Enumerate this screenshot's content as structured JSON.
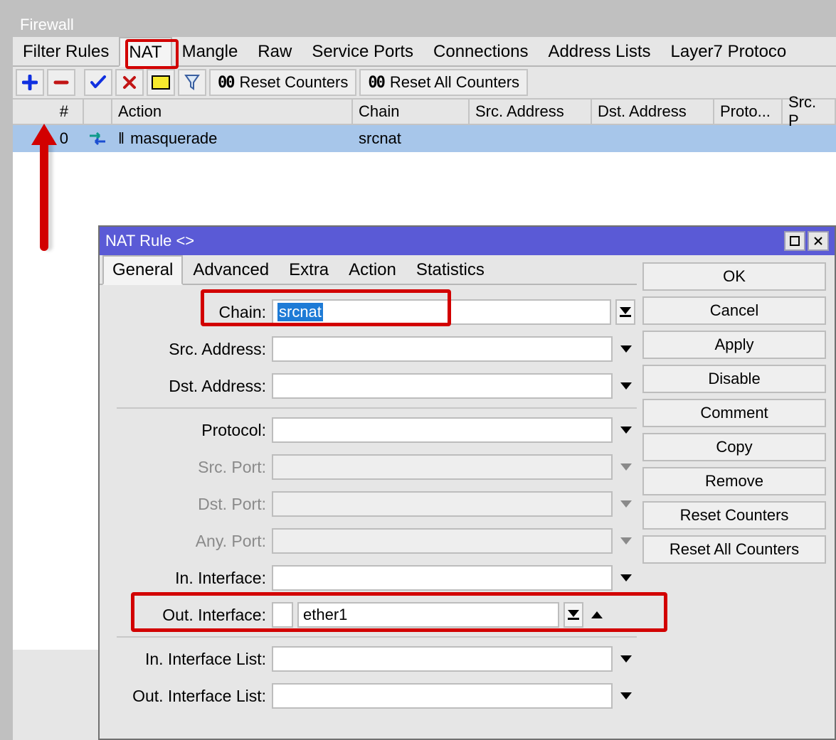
{
  "fw": {
    "title": "Firewall",
    "tabs": [
      "Filter Rules",
      "NAT",
      "Mangle",
      "Raw",
      "Service Ports",
      "Connections",
      "Address Lists",
      "Layer7 Protoco"
    ],
    "active_tab_index": 1,
    "toolbar": {
      "reset": "Reset Counters",
      "reset_all": "Reset All Counters"
    },
    "columns": {
      "idx": "#",
      "action": "Action",
      "chain": "Chain",
      "src": "Src. Address",
      "dst": "Dst. Address",
      "proto": "Proto...",
      "srcp": "Src. P"
    },
    "rows": [
      {
        "index": "0",
        "action": "masquerade",
        "chain": "srcnat",
        "src": "",
        "dst": "",
        "proto": "",
        "srcp": ""
      }
    ]
  },
  "dlg": {
    "title": "NAT Rule <>",
    "tabs": [
      "General",
      "Advanced",
      "Extra",
      "Action",
      "Statistics"
    ],
    "active_tab_index": 0,
    "fields": {
      "chain": {
        "label": "Chain:",
        "value": "srcnat"
      },
      "srcaddr": {
        "label": "Src. Address:",
        "value": ""
      },
      "dstaddr": {
        "label": "Dst. Address:",
        "value": ""
      },
      "protocol": {
        "label": "Protocol:",
        "value": ""
      },
      "srcport": {
        "label": "Src. Port:",
        "value": ""
      },
      "dstport": {
        "label": "Dst. Port:",
        "value": ""
      },
      "anyport": {
        "label": "Any. Port:",
        "value": ""
      },
      "iniface": {
        "label": "In. Interface:",
        "value": ""
      },
      "outiface": {
        "label": "Out. Interface:",
        "value": "ether1"
      },
      "inifacel": {
        "label": "In. Interface List:",
        "value": ""
      },
      "outifacel": {
        "label": "Out. Interface List:",
        "value": ""
      }
    },
    "buttons": [
      "OK",
      "Cancel",
      "Apply",
      "Disable",
      "Comment",
      "Copy",
      "Remove",
      "Reset Counters",
      "Reset All Counters"
    ]
  }
}
